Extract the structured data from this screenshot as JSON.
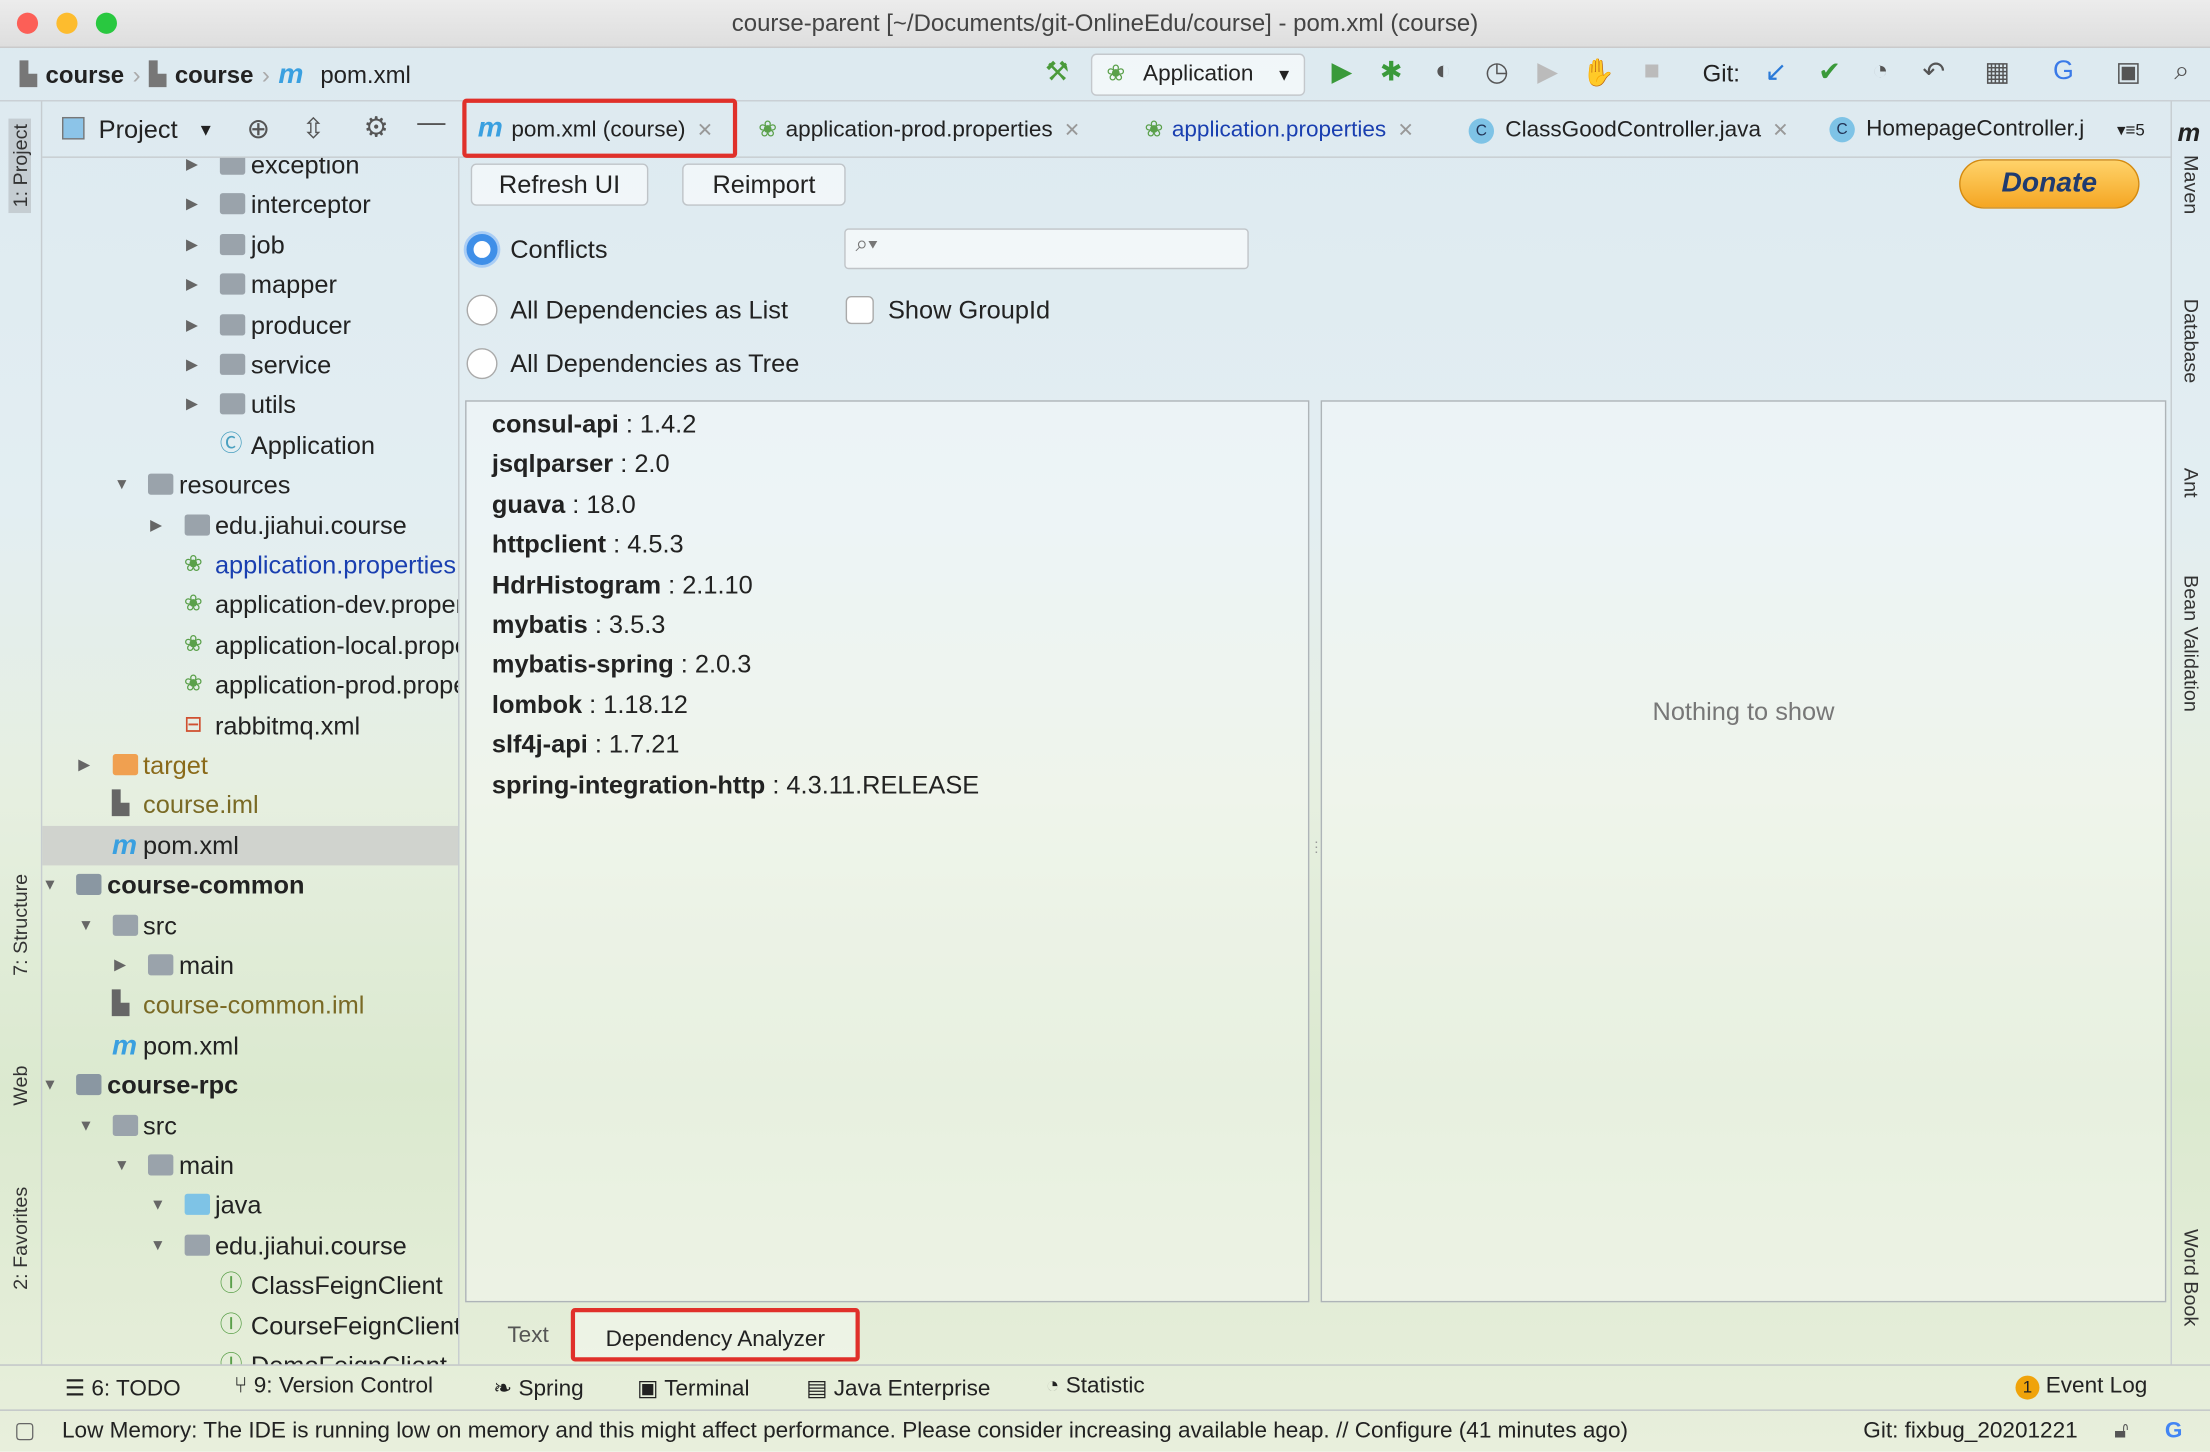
{
  "window": {
    "title": "course-parent [~/Documents/git-OnlineEdu/course] - pom.xml (course)"
  },
  "nav": {
    "crumbs": [
      "course",
      "course",
      "pom.xml"
    ],
    "run_config": "Application",
    "git_label": "Git:"
  },
  "left_strip": [
    "1: Project",
    "7: Structure",
    "Web",
    "2: Favorites"
  ],
  "right_strip": [
    "Maven",
    "Database",
    "Ant",
    "Bean Validation",
    "Word Book"
  ],
  "project": {
    "title": "Project",
    "tree": [
      {
        "label": "exception",
        "depth": 5,
        "type": "folder",
        "arrow": "collapsed"
      },
      {
        "label": "interceptor",
        "depth": 5,
        "type": "folder",
        "arrow": "collapsed"
      },
      {
        "label": "job",
        "depth": 5,
        "type": "folder",
        "arrow": "collapsed"
      },
      {
        "label": "mapper",
        "depth": 5,
        "type": "folder",
        "arrow": "collapsed"
      },
      {
        "label": "producer",
        "depth": 5,
        "type": "folder",
        "arrow": "collapsed"
      },
      {
        "label": "service",
        "depth": 5,
        "type": "folder",
        "arrow": "collapsed"
      },
      {
        "label": "utils",
        "depth": 5,
        "type": "folder",
        "arrow": "collapsed"
      },
      {
        "label": "Application",
        "depth": 5,
        "type": "spring-class"
      },
      {
        "label": "resources",
        "depth": 3,
        "type": "folder",
        "arrow": "expanded"
      },
      {
        "label": "edu.jiahui.course",
        "depth": 4,
        "type": "folder",
        "arrow": "collapsed"
      },
      {
        "label": "application.properties",
        "depth": 4,
        "type": "props",
        "color": "#1a3fb0"
      },
      {
        "label": "application-dev.properties",
        "depth": 4,
        "type": "props"
      },
      {
        "label": "application-local.properties",
        "depth": 4,
        "type": "props"
      },
      {
        "label": "application-prod.properties",
        "depth": 4,
        "type": "props"
      },
      {
        "label": "rabbitmq.xml",
        "depth": 4,
        "type": "xml"
      },
      {
        "label": "target",
        "depth": 2,
        "type": "folder-orange",
        "arrow": "collapsed",
        "color": "#8a6a1a"
      },
      {
        "label": "course.iml",
        "depth": 2,
        "type": "iml",
        "color": "#7a6a25"
      },
      {
        "label": "pom.xml",
        "depth": 2,
        "type": "maven",
        "selected": true
      },
      {
        "label": "course-common",
        "depth": 1,
        "type": "module",
        "arrow": "expanded",
        "bold": true
      },
      {
        "label": "src",
        "depth": 2,
        "type": "folder",
        "arrow": "expanded"
      },
      {
        "label": "main",
        "depth": 3,
        "type": "folder",
        "arrow": "collapsed"
      },
      {
        "label": "course-common.iml",
        "depth": 2,
        "type": "iml",
        "color": "#7a6a25"
      },
      {
        "label": "pom.xml",
        "depth": 2,
        "type": "maven"
      },
      {
        "label": "course-rpc",
        "depth": 1,
        "type": "module",
        "arrow": "expanded",
        "bold": true
      },
      {
        "label": "src",
        "depth": 2,
        "type": "folder",
        "arrow": "expanded"
      },
      {
        "label": "main",
        "depth": 3,
        "type": "folder",
        "arrow": "expanded"
      },
      {
        "label": "java",
        "depth": 4,
        "type": "folder-blue",
        "arrow": "expanded"
      },
      {
        "label": "edu.jiahui.course",
        "depth": 4,
        "type": "folder",
        "arrow": "expanded",
        "shift": 1
      },
      {
        "label": "ClassFeignClient",
        "depth": 5,
        "type": "interface"
      },
      {
        "label": "CourseFeignClient",
        "depth": 5,
        "type": "interface"
      },
      {
        "label": "DemoFeignClient",
        "depth": 5,
        "type": "interface"
      }
    ]
  },
  "tabs": [
    {
      "label": "pom.xml (course)",
      "icon": "maven",
      "active": true
    },
    {
      "label": "application-prod.properties",
      "icon": "props"
    },
    {
      "label": "application.properties",
      "icon": "props",
      "color": "#1a3fb0"
    },
    {
      "label": "ClassGoodController.java",
      "icon": "class"
    },
    {
      "label": "HomepageController.j",
      "icon": "class"
    }
  ],
  "tabs_overflow": "5",
  "analyzer": {
    "refresh_label": "Refresh UI",
    "reimport_label": "Reimport",
    "donate_label": "Donate",
    "modes": [
      {
        "label": "Conflicts",
        "selected": true
      },
      {
        "label": "All Dependencies as List",
        "selected": false
      },
      {
        "label": "All Dependencies as Tree",
        "selected": false
      }
    ],
    "search_placeholder": "",
    "show_groupid_label": "Show GroupId",
    "show_groupid_checked": false,
    "dependencies": [
      {
        "name": "consul-api",
        "version": "1.4.2"
      },
      {
        "name": "jsqlparser",
        "version": "2.0"
      },
      {
        "name": "guava",
        "version": "18.0"
      },
      {
        "name": "httpclient",
        "version": "4.5.3"
      },
      {
        "name": "HdrHistogram",
        "version": "2.1.10"
      },
      {
        "name": "mybatis",
        "version": "3.5.3"
      },
      {
        "name": "mybatis-spring",
        "version": "2.0.3"
      },
      {
        "name": "lombok",
        "version": "1.18.12"
      },
      {
        "name": "slf4j-api",
        "version": "1.7.21"
      },
      {
        "name": "spring-integration-http",
        "version": "4.3.11.RELEASE"
      }
    ],
    "empty_text": "Nothing to show",
    "bottom_tabs": [
      "Text",
      "Dependency Analyzer"
    ]
  },
  "toolwindows": [
    "6: TODO",
    "9: Version Control",
    "Spring",
    "Terminal",
    "Java Enterprise",
    "Statistic"
  ],
  "event_log": {
    "label": "Event Log",
    "count": "1"
  },
  "status": {
    "message": "Low Memory: The IDE is running low on memory and this might affect performance. Please consider increasing available heap. // Configure (41 minutes ago)",
    "branch": "Git: fixbug_20201221"
  },
  "colors": {
    "accent": "#3f8fe8",
    "highlight": "#e0302a",
    "donate": "#f5a623"
  }
}
